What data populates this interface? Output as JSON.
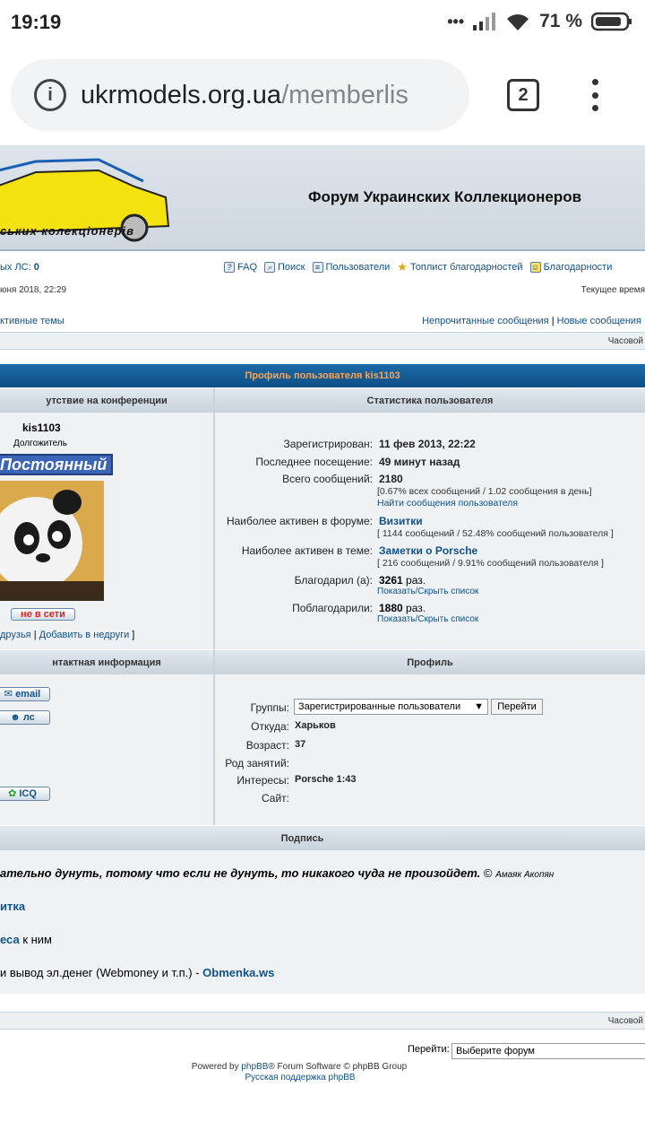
{
  "status_bar": {
    "time": "19:19",
    "signal_dots": "•••",
    "battery": "71 %"
  },
  "browser": {
    "url_host": "ukrmodels.org.ua",
    "url_path": "/memberlis",
    "tab_count": "2"
  },
  "header": {
    "logo_text": "ських колекціонерів",
    "site_title": "Форум Украинских Коллекционеров"
  },
  "topbar": {
    "new_pm_label": "ых ЛС:",
    "new_pm_count": "0",
    "nav": [
      {
        "label": "FAQ",
        "icon": "faq-icon"
      },
      {
        "label": "Поиск",
        "icon": "search-icon"
      },
      {
        "label": "Пользователи",
        "icon": "members-icon"
      },
      {
        "label": "Топлист благодарностей",
        "icon": "star-icon"
      },
      {
        "label": "Благодарности",
        "icon": "thanks-icon"
      }
    ],
    "last_visit": "юня 2018, 22:29",
    "current_time": "Текущее время",
    "active_topics": "ктивные темы",
    "unread": "Непрочитанные сообщения",
    "separator": "|",
    "new_posts": "Новые сообщения",
    "timezone": "Часовой"
  },
  "profile": {
    "heading": "Профиль пользователя kis1103",
    "left_cat": "утствие на конференции",
    "right_cat": "Статистика пользователя",
    "username": "kis1103",
    "rank": "Долгожитель",
    "rank_badge": "Постоянный",
    "offline": "не в сети",
    "friends_link": "друзья",
    "foes_link": "Добавить в недруги",
    "stats": {
      "registered_label": "Зарегистрирован:",
      "registered": "11 фев 2013, 22:22",
      "last_visit_label": "Последнее посещение:",
      "last_visit": "49 минут назад",
      "posts_label": "Всего сообщений:",
      "posts": "2180",
      "posts_detail": "[0.67% всех сообщений / 1.02 сообщения в день]",
      "find_posts": "Найти сообщения пользователя",
      "active_forum_label": "Наиболее активен в форуме:",
      "active_forum": "Визитки",
      "active_forum_detail": "[ 1144 сообщений / 52.48% сообщений пользователя ]",
      "active_topic_label": "Наиболее активен в теме:",
      "active_topic": "Заметки о Porsche",
      "active_topic_detail": "[ 216 сообщений / 9.91% сообщений пользователя ]",
      "thanked_label": "Благодарил (а):",
      "thanked": "3261",
      "times": "раз.",
      "toggle": "Показать/Скрыть список",
      "was_thanked_label": "Поблагодарили:",
      "was_thanked": "1880"
    },
    "contact_cat": "нтактная информация",
    "profile_cat": "Профиль",
    "contact_buttons": {
      "email": "email",
      "pm": "лс",
      "icq": "ICQ"
    },
    "fields": {
      "groups_label": "Группы:",
      "groups_value": "Зарегистрированные пользователи",
      "go": "Перейти",
      "from_label": "Откуда:",
      "from": "Харьков",
      "age_label": "Возраст:",
      "age": "37",
      "occupation_label": "Род занятий:",
      "interests_label": "Интересы:",
      "interests": "Porsche 1:43",
      "site_label": "Сайт:"
    },
    "signature_cat": "Подпись",
    "signature": {
      "quote": "ательно дунуть, потому что если не дунуть, то никакого чуда не произойдет.",
      "copyright": "©",
      "author": "Амаяк Акопян",
      "line2": "итка",
      "line3_link": "еса",
      "line3_text": "к ним",
      "line4_text": "и вывод эл.денег (Webmoney и т.п.) -",
      "line4_link": "Obmenka.ws"
    }
  },
  "footer": {
    "timezone": "Часовой",
    "jump_label": "Перейти:",
    "jump_select": "Выберите форум",
    "powered_prefix": "Powered by",
    "phpbb": "phpBB",
    "powered_suffix": "® Forum Software © phpBB Group",
    "support": "Русская поддержка phpBB"
  }
}
